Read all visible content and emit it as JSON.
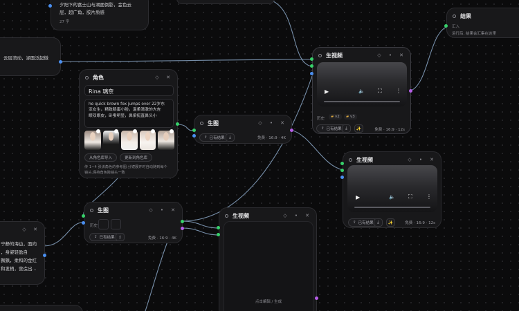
{
  "nodes": {
    "prompt_top": {
      "line1": "夕阳下的富士山与湖面倒影，金色云",
      "line2": "层，超广角，胶片质感",
      "count": "27 字"
    },
    "prompt_left": {
      "text": "云层流动，湖面泛起微"
    },
    "role": {
      "title": "角色",
      "name": "Rina 璃奈",
      "desc_1": "he quick brown fox jumps over 22岁东",
      "desc_2": "亚女生，精致鹅蛋小脸，温柔清澈的大杏",
      "desc_3": "眼双眼皮，卧蚕明显，鼻梁挺直鼻头小",
      "btn_import": "从角色库导入",
      "btn_update": "更新到角色库",
      "hint_1": "传 1~4 张该角色的参考图;分镜展开时自动随到每个",
      "hint_2": "镜头,保持角色跨镜头一致"
    },
    "gen_image_1": {
      "title": "生图",
      "existing": "已有结果",
      "meta": "免费 · 16:9 · 4K"
    },
    "gen_image_2": {
      "title": "生图",
      "history": "历史",
      "existing": "已有结果",
      "meta": "免费 · 16:9 · 4K"
    },
    "gen_video_1": {
      "title": "生视频",
      "history": "历史",
      "h1": "v2",
      "h2": "v3",
      "existing": "已有结果",
      "meta": "免费 · 16:9 · 12s"
    },
    "gen_video_2": {
      "title": "生视频",
      "existing": "已有结果",
      "meta": "免费 · 16:9 · 12s"
    },
    "gen_video_3": {
      "title": "生视频",
      "placeholder": "点击编辑 / 生成"
    },
    "result": {
      "title": "结果",
      "label": "汇入",
      "desc": "运行后, 结果会汇集在这里"
    },
    "partial_bottom_left": {
      "line1": "宁静的海边，面向",
      "line2": "，身姿轻盈自",
      "line3": "飘飘，柔和的金红",
      "line4": "和发梢，营造出..."
    }
  },
  "icons": [
    "tag-icon",
    "more-icon",
    "close-icon",
    "play-icon",
    "volume-icon",
    "fullscreen-icon",
    "download-icon",
    "sparkle-icon",
    "upload-icon"
  ],
  "colors": {
    "canvas": "#0b0b0c",
    "node": "#18181a",
    "port_input": "#37d06a",
    "port_text": "#4a8ff0",
    "port_output": "#b65ee8",
    "wire": "#8fb8e8"
  }
}
